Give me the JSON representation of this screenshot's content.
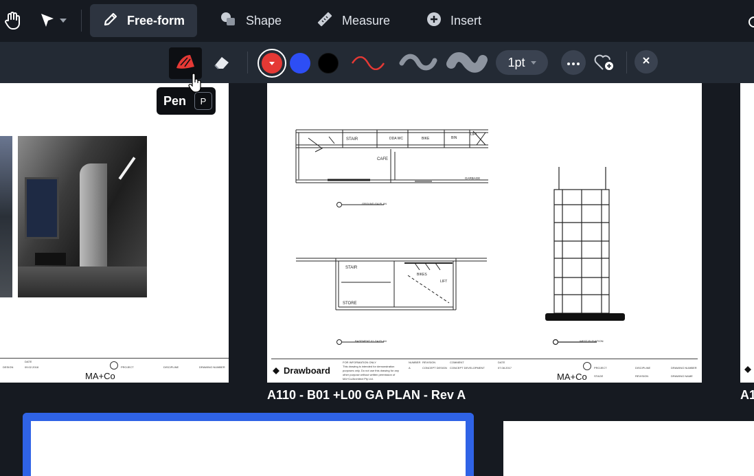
{
  "toolbar": {
    "modes": [
      {
        "label": "Free-form",
        "active": true,
        "icon": "pencil-icon"
      },
      {
        "label": "Shape",
        "active": false,
        "icon": "shapes-icon"
      },
      {
        "label": "Measure",
        "active": false,
        "icon": "ruler-icon"
      },
      {
        "label": "Insert",
        "active": false,
        "icon": "plus-circle-icon"
      }
    ]
  },
  "subtoolbar": {
    "pen_icon": "pen-icon",
    "eraser_icon": "eraser-icon",
    "colors": {
      "selected": "#e53935",
      "blue": "#2d4ef5",
      "black": "#000000"
    },
    "stroke_width": "1pt"
  },
  "tooltip": {
    "label": "Pen",
    "shortcut": "P"
  },
  "sheets": {
    "center": {
      "title": "A110 - B01 +L00 GA PLAN - Rev A",
      "brand": "Drawboard",
      "firm": "MA+Co",
      "labels": {
        "stair": "STAIR",
        "cafe": "CAFE",
        "store": "STORE",
        "bikes": "BIKES",
        "bin": "BIN",
        "garbage": "GARBAGE",
        "lift": "LIFT",
        "dda_wc": "DDA WC",
        "bike": "BIKE",
        "ground_plan": "GROUND GA PLAN",
        "basement_plan": "BASEMENT 01 GA PLAN",
        "west_elevation": "WEST ELEVATION"
      }
    },
    "left": {
      "firm": "MA+Co"
    },
    "right": {
      "title_fragment": "A1"
    }
  }
}
